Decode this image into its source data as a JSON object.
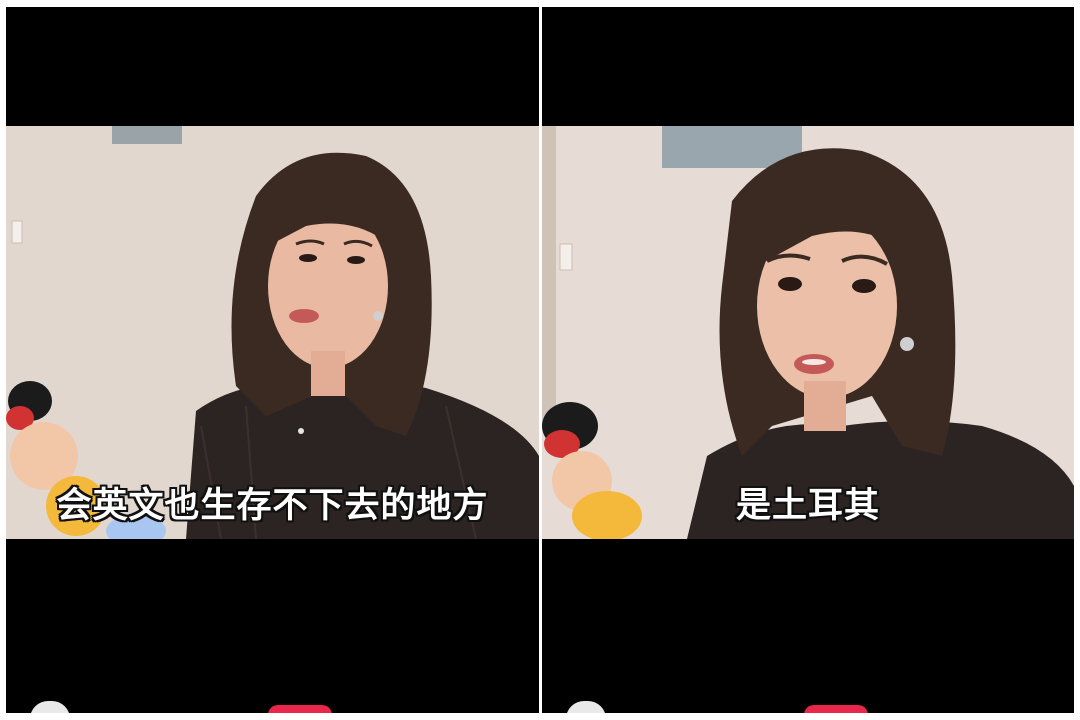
{
  "panels": [
    {
      "caption": "会英文也生存不下去的地方"
    },
    {
      "caption": "是土耳其"
    }
  ],
  "colors": {
    "letterbox": "#000000",
    "wall": "#e7ddd6",
    "hair": "#3b2a22",
    "skin": "#e9b9a2",
    "shirt": "#2c2422",
    "like_accent": "#e8274b"
  }
}
